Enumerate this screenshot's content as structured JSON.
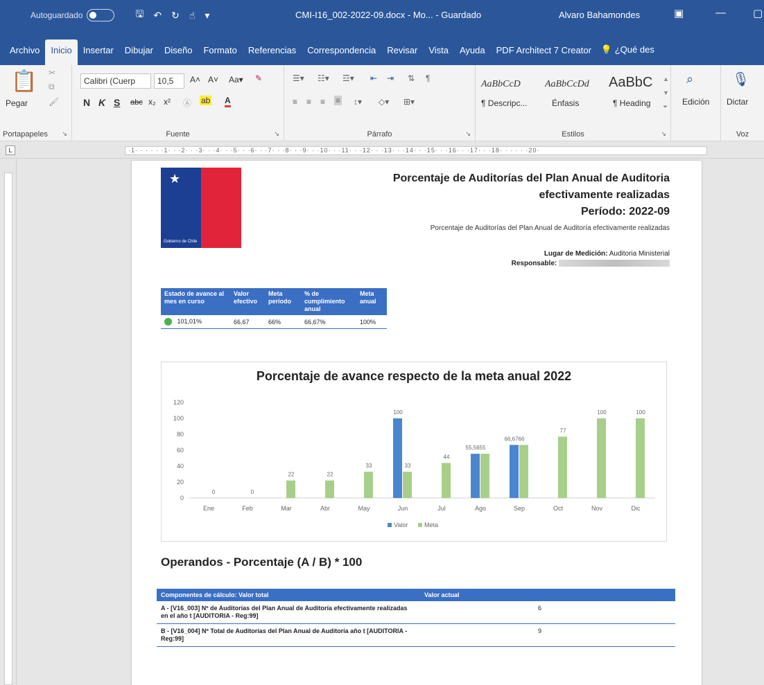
{
  "titlebar": {
    "autosave_label": "Autoguardado",
    "doc_name": "CMI-I16_002-2022-09.docx - Mo...",
    "saved_state": "Guardado",
    "user_name": "Alvaro Bahamondes"
  },
  "tabs": [
    "Archivo",
    "Inicio",
    "Insertar",
    "Dibujar",
    "Diseño",
    "Formato",
    "Referencias",
    "Correspondencia",
    "Revisar",
    "Vista",
    "Ayuda",
    "PDF Architect 7 Creator"
  ],
  "tab_search": "¿Qué des",
  "ribbon": {
    "paste_label": "Pegar",
    "clipboard_group": "Portapapeles",
    "font_name": "Calibri (Cuerp",
    "font_size": "10,5",
    "font_group": "Fuente",
    "paragraph_group": "Párrafo",
    "styles": [
      {
        "sample": "AaBbCcD",
        "name": "¶ Descripc..."
      },
      {
        "sample": "AaBbCcDd",
        "name": "Énfasis"
      },
      {
        "sample": "AaBbC",
        "name": "¶ Heading"
      }
    ],
    "styles_group": "Estilos",
    "edit_label": "Edición",
    "dictate_label": "Dictar",
    "voice_group": "Voz"
  },
  "ruler_text": "·1· · ·  · · ·1· · ·2· · ·3· · ·4· · ·5· · ·6· · ·7· · ·8· · ·9· · ·10· · ·11· · ·12· · ·13· · ·14· · ·15· · ·16· · ·17· · ·18· · ·  · · ·20·",
  "document": {
    "heading_line1": "Porcentaje de Auditorías del Plan Anual de Auditoria",
    "heading_line2": "efectivamente realizadas",
    "heading_line3": "Período: 2022-09",
    "subtitle": "Porcentaje de Auditorías del Plan Anual de Auditoría efectivamente realizadas",
    "place_label": "Lugar de Medición:",
    "place_value": "Auditoria Ministerial",
    "responsible_label": "Responsable:",
    "flag_caption": "Gobierno de Chile",
    "kpi_headers": [
      "Estado de avance al mes en curso",
      "Valor efectivo",
      "Meta período",
      "% de cumplimiento anual",
      "Meta anual"
    ],
    "kpi_values": [
      "101,01%",
      "66,67",
      "66%",
      "66,67%",
      "100%"
    ],
    "operands_title": "Operandos - Porcentaje (A / B) * 100",
    "ops_headers": [
      "Componentes de cálculo: Valor total",
      "Valor actual"
    ],
    "ops_rows": [
      {
        "label": "A - [V16_003] Nº de Auditorías del Plan Anual de Auditoría efectivamente realizadas en el año t [AUDITORIA - Reg:99]",
        "value": "6"
      },
      {
        "label": "B - [V16_004] Nº Total de Auditorías del Plan Anual de Auditoría año t [AUDITORIA - Reg:99]",
        "value": "9"
      }
    ]
  },
  "chart_data": {
    "type": "bar",
    "title": "Porcentaje de avance respecto de la meta anual 2022",
    "categories": [
      "Ene",
      "Feb",
      "Mar",
      "Abr",
      "May",
      "Jun",
      "Jul",
      "Ago",
      "Sep",
      "Oct",
      "Nov",
      "Dic"
    ],
    "series": [
      {
        "name": "Valor",
        "color": "#4a86d0",
        "values": [
          null,
          null,
          null,
          null,
          null,
          100,
          null,
          55.5655,
          66.6766,
          null,
          null,
          null
        ]
      },
      {
        "name": "Meta",
        "color": "#a8cf8a",
        "values": [
          0,
          0,
          22,
          22,
          33,
          33,
          44,
          55.5655,
          66.6766,
          77,
          100,
          100
        ]
      }
    ],
    "labels": {
      "Valor": [
        "",
        "",
        "",
        "",
        "",
        "100",
        "",
        "55,5655",
        "66,6766",
        "",
        "",
        ""
      ],
      "Meta": [
        "0",
        "0",
        "22",
        "22",
        "33",
        "33",
        "44",
        "",
        "",
        "77",
        "100",
        "100"
      ]
    },
    "ylim": [
      0,
      120
    ],
    "yticks": [
      0,
      20,
      40,
      60,
      80,
      100,
      120
    ],
    "legend": "bottom",
    "grid": false
  }
}
